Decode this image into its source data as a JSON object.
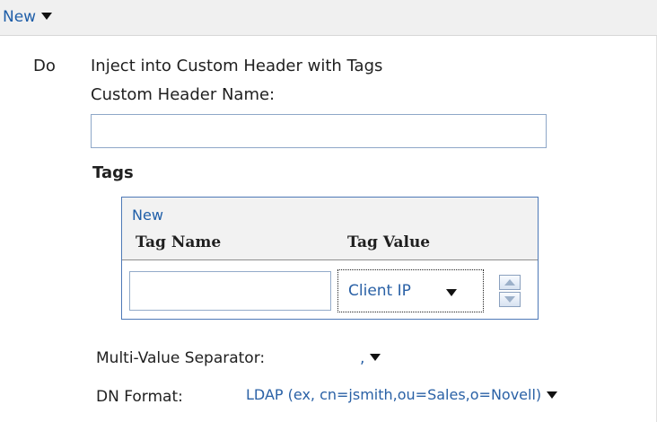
{
  "top": {
    "new_label": "New"
  },
  "rule": {
    "do_label": "Do",
    "action_title": "Inject into Custom Header with Tags",
    "custom_header_label": "Custom Header Name:",
    "custom_header_value": ""
  },
  "tags": {
    "section_label": "Tags",
    "new_label": "New",
    "columns": [
      "Tag Name",
      "Tag Value"
    ],
    "row": {
      "tag_name_value": "",
      "tag_value": "Client IP"
    }
  },
  "options": {
    "multi_value_separator_label": "Multi-Value Separator:",
    "multi_value_separator_value": ",",
    "dn_format_label": "DN Format:",
    "dn_format_value": "LDAP (ex, cn=jsmith,ou=Sales,o=Novell)"
  },
  "icons": {
    "dropdown": "caret-down-icon",
    "spinner": "up-down-spinner-icon"
  },
  "colors": {
    "link_blue": "#2a61a6",
    "border_blue": "#4e79b7",
    "toolbar_gray": "#f0f0f0"
  }
}
